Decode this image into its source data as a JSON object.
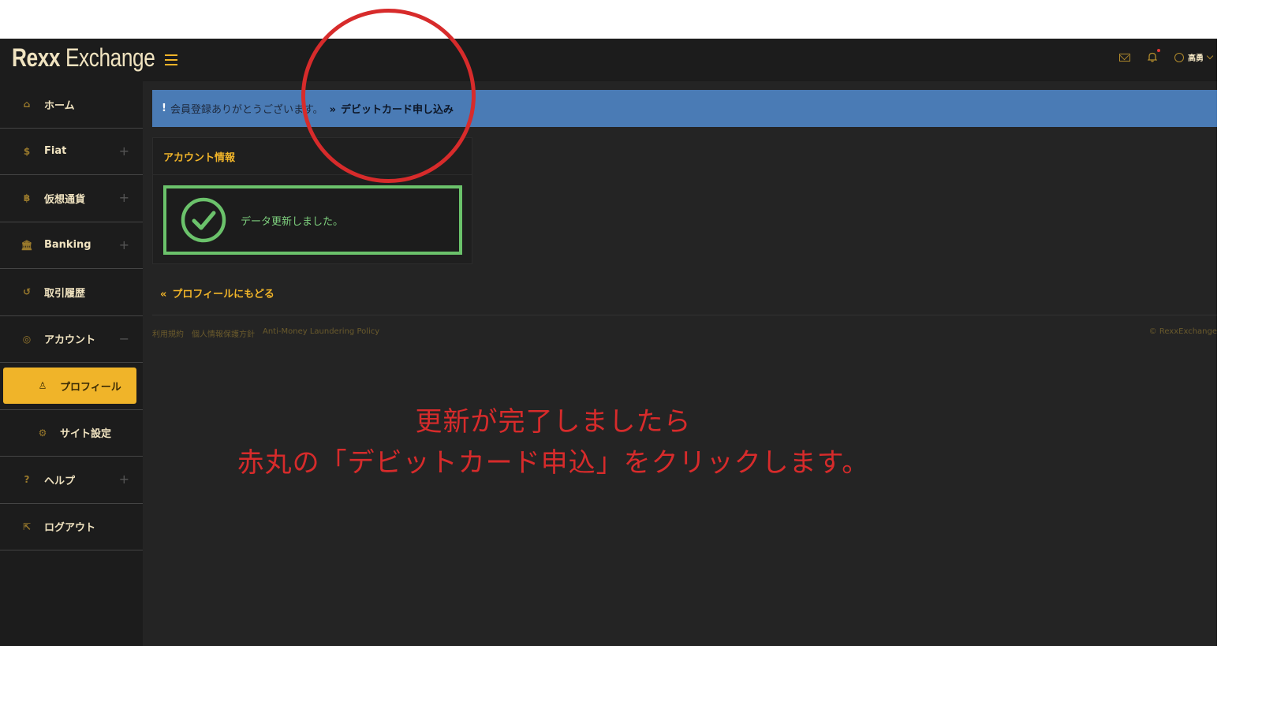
{
  "app": {
    "logo_bold": "Rexx",
    "logo_rest": " Exchange"
  },
  "header": {
    "user_name": "高勇"
  },
  "sidebar": {
    "items": [
      {
        "label": "ホーム",
        "icon": "home-icon",
        "glyph": "⌂",
        "expand": ""
      },
      {
        "label": "Fiat",
        "icon": "dollar-icon",
        "glyph": "$",
        "expand": "+"
      },
      {
        "label": "仮想通貨",
        "icon": "bitcoin-icon",
        "glyph": "฿",
        "expand": "+"
      },
      {
        "label": "Banking",
        "icon": "bank-icon",
        "glyph": "🏛",
        "expand": "+"
      },
      {
        "label": "取引履歴",
        "icon": "history-icon",
        "glyph": "↺",
        "expand": ""
      },
      {
        "label": "アカウント",
        "icon": "account-icon",
        "glyph": "◎",
        "expand": "−"
      },
      {
        "label": "プロフィール",
        "icon": "user-icon",
        "glyph": "♙",
        "expand": ""
      },
      {
        "label": "サイト設定",
        "icon": "gear-icon",
        "glyph": "⚙",
        "expand": ""
      },
      {
        "label": "ヘルプ",
        "icon": "help-icon",
        "glyph": "?",
        "expand": "+"
      },
      {
        "label": "ログアウト",
        "icon": "logout-icon",
        "glyph": "⇱",
        "expand": ""
      }
    ]
  },
  "banner": {
    "excl": "!",
    "message": "会員登録ありがとうございます。",
    "link_arrow": "»",
    "link_label": "デビットカード申し込み"
  },
  "card": {
    "title": "アカウント情報",
    "alert_message": "データ更新しました。"
  },
  "back_link": {
    "arrow": "«",
    "label": "プロフィールにもどる"
  },
  "footer": {
    "links": [
      "利用規約",
      "個人情報保護方針",
      "Anti-Money Laundering Policy"
    ],
    "copyright": "© RexxExchange"
  },
  "annotation": {
    "line1": "更新が完了しましたら",
    "line2": "赤丸の「デビットカード申込」をクリックします。"
  },
  "colors": {
    "accent": "#f0b429",
    "banner": "#4a7bb5",
    "success": "#6bc26b",
    "annotation": "#d72b2b"
  }
}
